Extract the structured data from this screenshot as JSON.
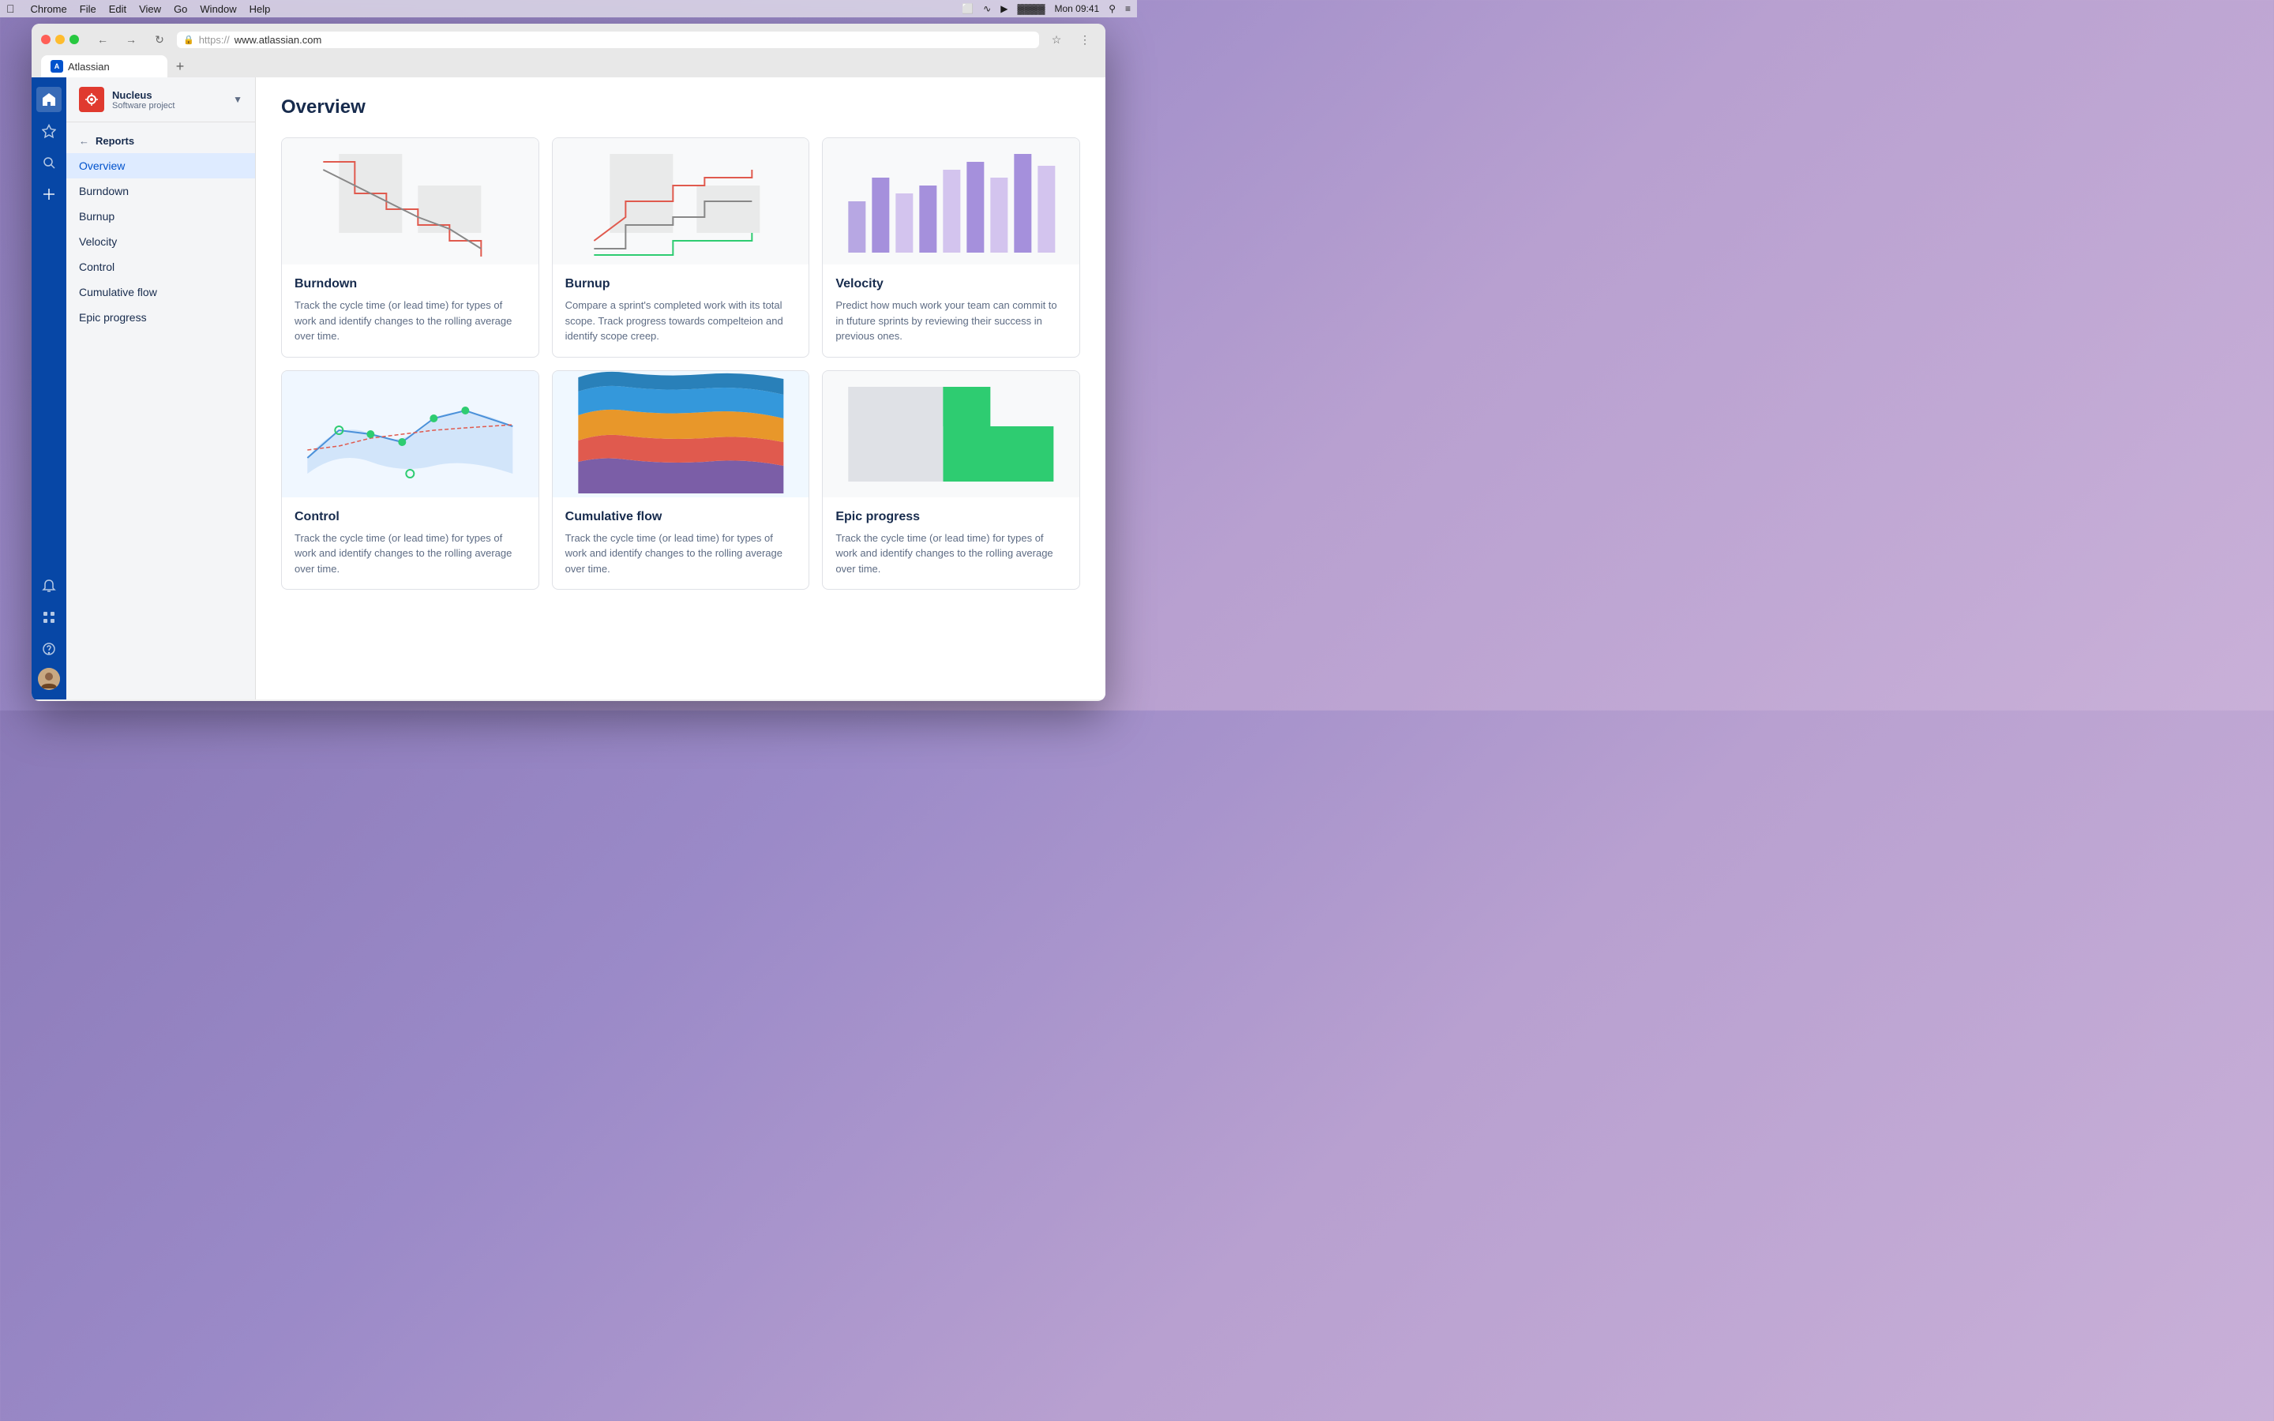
{
  "menubar": {
    "apple": "⌘",
    "items": [
      "Chrome",
      "File",
      "Edit",
      "View",
      "Go",
      "Window",
      "Help"
    ],
    "time": "Mon 09:41",
    "right_icons": [
      "cast",
      "wifi",
      "volume",
      "battery"
    ]
  },
  "browser": {
    "tab_label": "Atlassian",
    "url": "https://  www.atlassian.com",
    "url_display": "www.atlassian.com"
  },
  "nav_rail": {
    "icons": [
      "diamond",
      "star",
      "search",
      "plus"
    ],
    "bottom_icons": [
      "bell",
      "grid",
      "help"
    ]
  },
  "sidebar": {
    "project_name": "Nucleus",
    "project_type": "Software project",
    "section_title": "Reports",
    "nav_items": [
      {
        "id": "overview",
        "label": "Overview",
        "active": true
      },
      {
        "id": "burndown",
        "label": "Burndown",
        "active": false
      },
      {
        "id": "burnup",
        "label": "Burnup",
        "active": false
      },
      {
        "id": "velocity",
        "label": "Velocity",
        "active": false
      },
      {
        "id": "control",
        "label": "Control",
        "active": false
      },
      {
        "id": "cumulative-flow",
        "label": "Cumulative flow",
        "active": false
      },
      {
        "id": "epic-progress",
        "label": "Epic progress",
        "active": false
      }
    ]
  },
  "main": {
    "page_title": "Overview",
    "reports": [
      {
        "id": "burndown",
        "title": "Burndown",
        "description": "Track the cycle time (or lead time) for types of work and identify changes to the rolling average over time.",
        "chart_type": "burndown"
      },
      {
        "id": "burnup",
        "title": "Burnup",
        "description": "Compare a sprint's completed work with its total scope. Track progress towards compelteion and identify scope creep.",
        "chart_type": "burnup"
      },
      {
        "id": "velocity",
        "title": "Velocity",
        "description": "Predict how much work your team can commit to in tfuture sprints by reviewing their success in previous ones.",
        "chart_type": "velocity"
      },
      {
        "id": "control",
        "title": "Control",
        "description": "Track the cycle time (or lead time) for types of work and identify changes to the rolling average over time.",
        "chart_type": "control"
      },
      {
        "id": "cumulative-flow",
        "title": "Cumulative flow",
        "description": "Track the cycle time (or lead time) for types of work and identify changes to the rolling average over time.",
        "chart_type": "cumulative"
      },
      {
        "id": "epic-progress",
        "title": "Epic progress",
        "description": "Track the cycle time (or lead time) for types of work and identify changes to the rolling average over time.",
        "chart_type": "epic"
      }
    ]
  }
}
